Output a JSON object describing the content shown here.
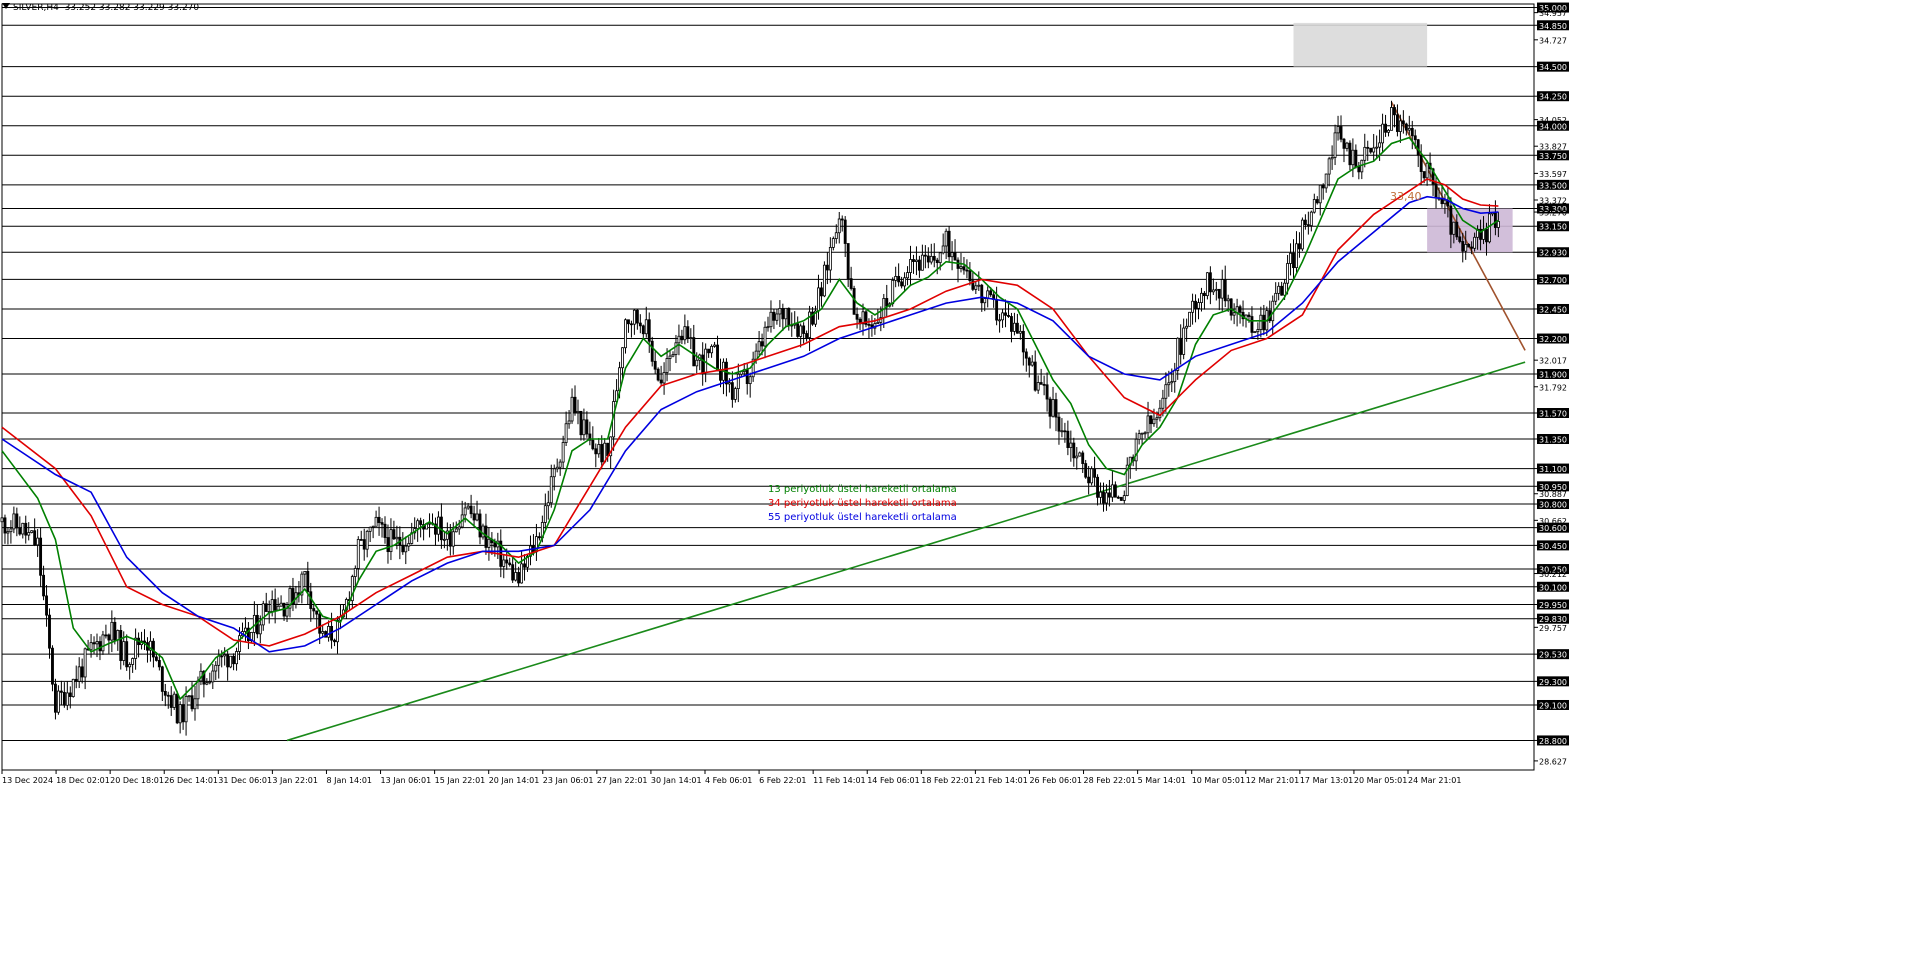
{
  "header": {
    "symbol": "SILVER,H4",
    "ohlc": "33.252 33.282 33.229 33.270"
  },
  "colors": {
    "background": "#ffffff",
    "candle": "#000000",
    "level_line": "#000000",
    "ema13": "#008000",
    "ema34": "#e00000",
    "ema55": "#0000e0",
    "uptrend": "#1a8a1a",
    "downtrend": "#a0522d",
    "resistance_zone": "#d9d9d9",
    "target_zone": "#cdb8d6"
  },
  "legend": [
    {
      "label": "13 periyotluk üstel hareketli ortalama",
      "color": "#008000"
    },
    {
      "label": "34 periyotluk üstel hareketli ortalama",
      "color": "#e00000"
    },
    {
      "label": "55 periyotluk üstel hareketli ortalama",
      "color": "#0000e0"
    }
  ],
  "annotation": {
    "text": "33,40",
    "color": "#c0703a"
  },
  "chart_data": {
    "type": "line",
    "symbol": "SILVER",
    "timeframe": "H4",
    "ylim": [
      28.55,
      35.03
    ],
    "price_axis_ticks": [
      "35.000",
      "34.957",
      "34.850",
      "34.727",
      "34.500",
      "34.250",
      "34.052",
      "34.000",
      "33.827",
      "33.750",
      "33.597",
      "33.500",
      "33.372",
      "33.300",
      "33.270",
      "33.150",
      "32.930",
      "32.700",
      "32.450",
      "32.200",
      "32.017",
      "31.900",
      "31.792",
      "31.570",
      "31.350",
      "31.100",
      "30.950",
      "30.887",
      "30.800",
      "30.662",
      "30.600",
      "30.450",
      "30.250",
      "30.212",
      "30.100",
      "29.950",
      "29.830",
      "29.757",
      "29.530",
      "29.300",
      "29.100",
      "28.800",
      "28.627"
    ],
    "horizontal_levels": [
      35.0,
      34.85,
      34.5,
      34.25,
      34.0,
      33.75,
      33.5,
      33.3,
      33.15,
      32.93,
      32.7,
      32.45,
      32.2,
      31.9,
      31.57,
      31.35,
      31.1,
      30.95,
      30.8,
      30.6,
      30.45,
      30.25,
      30.1,
      29.95,
      29.83,
      29.53,
      29.3,
      29.1,
      28.8
    ],
    "x_labels": [
      "13 Dec 2024",
      "18 Dec 02:01",
      "20 Dec 18:01",
      "26 Dec 14:01",
      "31 Dec 06:01",
      "3 Jan 22:01",
      "8 Jan 14:01",
      "13 Jan 06:01",
      "15 Jan 22:01",
      "20 Jan 14:01",
      "23 Jan 06:01",
      "27 Jan 22:01",
      "30 Jan 14:01",
      "4 Feb 06:01",
      "6 Feb 22:01",
      "11 Feb 14:01",
      "14 Feb 06:01",
      "18 Feb 22:01",
      "21 Feb 14:01",
      "26 Feb 06:01",
      "28 Feb 22:01",
      "5 Mar 14:01",
      "10 Mar 05:01",
      "12 Mar 21:01",
      "17 Mar 13:01",
      "20 Mar 05:01",
      "24 Mar 21:01"
    ],
    "price_path": [
      [
        0,
        30.65
      ],
      [
        1,
        30.6
      ],
      [
        2,
        30.45
      ],
      [
        3,
        29.1
      ],
      [
        4,
        29.3
      ],
      [
        5,
        29.55
      ],
      [
        6,
        29.75
      ],
      [
        7,
        29.5
      ],
      [
        8,
        29.7
      ],
      [
        9,
        29.3
      ],
      [
        10,
        29.0
      ],
      [
        11,
        29.25
      ],
      [
        12,
        29.45
      ],
      [
        13,
        29.55
      ],
      [
        14,
        29.7
      ],
      [
        15,
        30.0
      ],
      [
        16,
        29.95
      ],
      [
        17,
        30.2
      ],
      [
        18,
        29.65
      ],
      [
        19,
        29.75
      ],
      [
        20,
        30.4
      ],
      [
        21,
        30.6
      ],
      [
        22,
        30.45
      ],
      [
        23,
        30.55
      ],
      [
        24,
        30.7
      ],
      [
        25,
        30.5
      ],
      [
        26,
        30.8
      ],
      [
        27,
        30.55
      ],
      [
        28,
        30.35
      ],
      [
        29,
        30.15
      ],
      [
        30,
        30.5
      ],
      [
        31,
        31.05
      ],
      [
        32,
        31.65
      ],
      [
        33,
        31.3
      ],
      [
        34,
        31.2
      ],
      [
        35,
        32.4
      ],
      [
        36,
        32.35
      ],
      [
        37,
        31.8
      ],
      [
        38,
        32.3
      ],
      [
        39,
        32.0
      ],
      [
        40,
        32.05
      ],
      [
        41,
        31.75
      ],
      [
        42,
        31.9
      ],
      [
        43,
        32.3
      ],
      [
        44,
        32.45
      ],
      [
        45,
        32.25
      ],
      [
        46,
        32.6
      ],
      [
        47,
        33.3
      ],
      [
        48,
        32.3
      ],
      [
        49,
        32.35
      ],
      [
        50,
        32.6
      ],
      [
        51,
        32.9
      ],
      [
        52,
        32.8
      ],
      [
        53,
        33.0
      ],
      [
        54,
        32.85
      ],
      [
        55,
        32.55
      ],
      [
        56,
        32.4
      ],
      [
        57,
        32.3
      ],
      [
        58,
        31.85
      ],
      [
        59,
        31.6
      ],
      [
        60,
        31.3
      ],
      [
        61,
        31.05
      ],
      [
        62,
        30.85
      ],
      [
        63,
        30.95
      ],
      [
        64,
        31.4
      ],
      [
        65,
        31.55
      ],
      [
        66,
        32.1
      ],
      [
        67,
        32.55
      ],
      [
        68,
        32.7
      ],
      [
        69,
        32.5
      ],
      [
        70,
        32.3
      ],
      [
        71,
        32.4
      ],
      [
        72,
        32.7
      ],
      [
        73,
        33.1
      ],
      [
        74,
        33.5
      ],
      [
        75,
        33.9
      ],
      [
        76,
        33.7
      ],
      [
        77,
        33.8
      ],
      [
        78,
        34.1
      ],
      [
        79,
        33.9
      ],
      [
        80,
        33.6
      ],
      [
        81,
        33.3
      ],
      [
        82,
        32.9
      ],
      [
        83,
        33.05
      ],
      [
        84,
        33.27
      ]
    ],
    "series": [
      {
        "name": "13 periyotluk üstel hareketli ortalama",
        "color": "#008000",
        "values": [
          [
            0,
            31.25
          ],
          [
            2,
            30.85
          ],
          [
            3,
            30.5
          ],
          [
            4,
            29.75
          ],
          [
            5,
            29.55
          ],
          [
            6,
            29.62
          ],
          [
            7,
            29.68
          ],
          [
            8,
            29.62
          ],
          [
            9,
            29.5
          ],
          [
            10,
            29.15
          ],
          [
            11,
            29.3
          ],
          [
            12,
            29.5
          ],
          [
            13,
            29.6
          ],
          [
            14,
            29.75
          ],
          [
            15,
            29.88
          ],
          [
            16,
            29.92
          ],
          [
            17,
            30.08
          ],
          [
            18,
            29.85
          ],
          [
            19,
            29.8
          ],
          [
            20,
            30.15
          ],
          [
            21,
            30.4
          ],
          [
            22,
            30.45
          ],
          [
            23,
            30.55
          ],
          [
            24,
            30.65
          ],
          [
            25,
            30.55
          ],
          [
            26,
            30.68
          ],
          [
            27,
            30.55
          ],
          [
            28,
            30.45
          ],
          [
            29,
            30.3
          ],
          [
            30,
            30.4
          ],
          [
            31,
            30.75
          ],
          [
            32,
            31.25
          ],
          [
            33,
            31.35
          ],
          [
            34,
            31.35
          ],
          [
            35,
            31.95
          ],
          [
            36,
            32.2
          ],
          [
            37,
            32.05
          ],
          [
            38,
            32.15
          ],
          [
            39,
            32.05
          ],
          [
            40,
            31.95
          ],
          [
            41,
            31.9
          ],
          [
            42,
            31.95
          ],
          [
            43,
            32.15
          ],
          [
            44,
            32.3
          ],
          [
            45,
            32.35
          ],
          [
            46,
            32.45
          ],
          [
            47,
            32.7
          ],
          [
            48,
            32.5
          ],
          [
            49,
            32.4
          ],
          [
            50,
            32.5
          ],
          [
            51,
            32.65
          ],
          [
            52,
            32.72
          ],
          [
            53,
            32.85
          ],
          [
            54,
            32.83
          ],
          [
            55,
            32.7
          ],
          [
            56,
            32.55
          ],
          [
            57,
            32.45
          ],
          [
            58,
            32.15
          ],
          [
            59,
            31.85
          ],
          [
            60,
            31.65
          ],
          [
            61,
            31.3
          ],
          [
            62,
            31.1
          ],
          [
            63,
            31.05
          ],
          [
            64,
            31.3
          ],
          [
            65,
            31.45
          ],
          [
            66,
            31.7
          ],
          [
            67,
            32.15
          ],
          [
            68,
            32.4
          ],
          [
            69,
            32.45
          ],
          [
            70,
            32.35
          ],
          [
            71,
            32.35
          ],
          [
            72,
            32.55
          ],
          [
            73,
            32.85
          ],
          [
            74,
            33.2
          ],
          [
            75,
            33.55
          ],
          [
            76,
            33.65
          ],
          [
            77,
            33.7
          ],
          [
            78,
            33.85
          ],
          [
            79,
            33.9
          ],
          [
            80,
            33.7
          ],
          [
            81,
            33.45
          ],
          [
            82,
            33.2
          ],
          [
            83,
            33.1
          ],
          [
            84,
            33.2
          ]
        ]
      },
      {
        "name": "34 periyotluk üstel hareketli ortalama",
        "color": "#e00000",
        "values": [
          [
            0,
            31.45
          ],
          [
            3,
            31.1
          ],
          [
            5,
            30.7
          ],
          [
            7,
            30.1
          ],
          [
            9,
            29.95
          ],
          [
            11,
            29.85
          ],
          [
            13,
            29.65
          ],
          [
            15,
            29.6
          ],
          [
            17,
            29.7
          ],
          [
            19,
            29.85
          ],
          [
            21,
            30.05
          ],
          [
            23,
            30.2
          ],
          [
            25,
            30.35
          ],
          [
            27,
            30.4
          ],
          [
            29,
            30.35
          ],
          [
            31,
            30.45
          ],
          [
            33,
            30.95
          ],
          [
            35,
            31.45
          ],
          [
            37,
            31.8
          ],
          [
            39,
            31.9
          ],
          [
            41,
            31.95
          ],
          [
            43,
            32.05
          ],
          [
            45,
            32.15
          ],
          [
            47,
            32.3
          ],
          [
            49,
            32.35
          ],
          [
            51,
            32.45
          ],
          [
            53,
            32.6
          ],
          [
            55,
            32.7
          ],
          [
            57,
            32.65
          ],
          [
            59,
            32.45
          ],
          [
            61,
            32.05
          ],
          [
            63,
            31.7
          ],
          [
            65,
            31.55
          ],
          [
            67,
            31.85
          ],
          [
            69,
            32.1
          ],
          [
            71,
            32.2
          ],
          [
            73,
            32.4
          ],
          [
            75,
            32.95
          ],
          [
            77,
            33.25
          ],
          [
            79,
            33.45
          ],
          [
            80,
            33.55
          ],
          [
            81,
            33.5
          ],
          [
            82,
            33.38
          ],
          [
            83,
            33.33
          ],
          [
            84,
            33.32
          ]
        ]
      },
      {
        "name": "55 periyotluk üstel hareketli ortalama",
        "color": "#0000e0",
        "values": [
          [
            0,
            31.35
          ],
          [
            3,
            31.05
          ],
          [
            5,
            30.9
          ],
          [
            7,
            30.35
          ],
          [
            9,
            30.05
          ],
          [
            11,
            29.85
          ],
          [
            13,
            29.75
          ],
          [
            15,
            29.55
          ],
          [
            17,
            29.6
          ],
          [
            19,
            29.75
          ],
          [
            21,
            29.95
          ],
          [
            23,
            30.15
          ],
          [
            25,
            30.3
          ],
          [
            27,
            30.4
          ],
          [
            29,
            30.4
          ],
          [
            31,
            30.45
          ],
          [
            33,
            30.75
          ],
          [
            35,
            31.25
          ],
          [
            37,
            31.6
          ],
          [
            39,
            31.75
          ],
          [
            41,
            31.85
          ],
          [
            43,
            31.95
          ],
          [
            45,
            32.05
          ],
          [
            47,
            32.2
          ],
          [
            49,
            32.3
          ],
          [
            51,
            32.4
          ],
          [
            53,
            32.5
          ],
          [
            55,
            32.55
          ],
          [
            57,
            32.5
          ],
          [
            59,
            32.35
          ],
          [
            61,
            32.05
          ],
          [
            63,
            31.9
          ],
          [
            65,
            31.85
          ],
          [
            67,
            32.05
          ],
          [
            69,
            32.15
          ],
          [
            71,
            32.25
          ],
          [
            73,
            32.5
          ],
          [
            75,
            32.85
          ],
          [
            77,
            33.1
          ],
          [
            79,
            33.35
          ],
          [
            80,
            33.4
          ],
          [
            81,
            33.38
          ],
          [
            82,
            33.3
          ],
          [
            83,
            33.26
          ],
          [
            84,
            33.27
          ]
        ]
      }
    ],
    "trendlines": [
      {
        "name": "uptrend",
        "from": [
          16,
          28.8
        ],
        "to": [
          85.5,
          32.0
        ]
      },
      {
        "name": "downtrend",
        "from": [
          78,
          34.2
        ],
        "to": [
          85.5,
          32.1
        ]
      }
    ],
    "zones": [
      {
        "name": "resistance-zone",
        "x": [
          72.5,
          80
        ],
        "y": [
          34.5,
          34.87
        ]
      },
      {
        "name": "target-zone",
        "x": [
          80,
          84.8
        ],
        "y": [
          32.93,
          33.3
        ]
      }
    ]
  }
}
